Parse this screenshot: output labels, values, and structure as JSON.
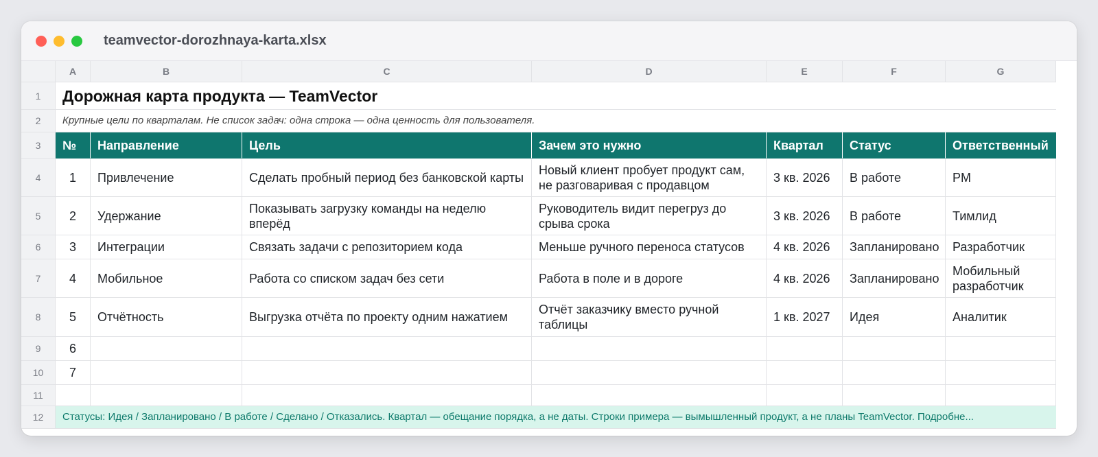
{
  "window": {
    "title": "teamvector-dorozhnaya-karta.xlsx"
  },
  "columns": [
    "A",
    "B",
    "C",
    "D",
    "E",
    "F",
    "G"
  ],
  "row_numbers": [
    "1",
    "2",
    "3",
    "4",
    "5",
    "6",
    "7",
    "8",
    "9",
    "10",
    "11",
    "12"
  ],
  "sheet": {
    "title": "Дорожная карта продукта — TeamVector",
    "subtitle": "Крупные цели по кварталам. Не список задач: одна строка — одна ценность для пользователя.",
    "headers": [
      "№",
      "Направление",
      "Цель",
      "Зачем это нужно",
      "Квартал",
      "Статус",
      "Ответственный"
    ],
    "rows": [
      {
        "n": "1",
        "area": "Привлечение",
        "goal": "Сделать пробный период без банковской карты",
        "why": "Новый клиент пробует продукт сам, не разговаривая с продавцом",
        "quarter": "3 кв. 2026",
        "status": "В работе",
        "owner": "PM"
      },
      {
        "n": "2",
        "area": "Удержание",
        "goal": "Показывать загрузку команды на неделю вперёд",
        "why": "Руководитель видит перегруз до срыва срока",
        "quarter": "3 кв. 2026",
        "status": "В работе",
        "owner": "Тимлид"
      },
      {
        "n": "3",
        "area": "Интеграции",
        "goal": "Связать задачи с репозиторием кода",
        "why": "Меньше ручного переноса статусов",
        "quarter": "4 кв. 2026",
        "status": "Запланировано",
        "owner": "Разработчик"
      },
      {
        "n": "4",
        "area": "Мобильное",
        "goal": "Работа со списком задач без сети",
        "why": "Работа в поле и в дороге",
        "quarter": "4 кв. 2026",
        "status": "Запланировано",
        "owner": "Мобильный разработчик"
      },
      {
        "n": "5",
        "area": "Отчётность",
        "goal": "Выгрузка отчёта по проекту одним нажатием",
        "why": "Отчёт заказчику вместо ручной таблицы",
        "quarter": "1 кв. 2027",
        "status": "Идея",
        "owner": "Аналитик"
      },
      {
        "n": "6",
        "area": "",
        "goal": "",
        "why": "",
        "quarter": "",
        "status": "",
        "owner": ""
      },
      {
        "n": "7",
        "area": "",
        "goal": "",
        "why": "",
        "quarter": "",
        "status": "",
        "owner": ""
      }
    ],
    "footer": "Статусы: Идея / Запланировано / В работе / Сделано / Отказались. Квартал — обещание порядка, а не даты. Строки примера — вымышленный продукт, а не планы TeamVector. Подробне..."
  }
}
